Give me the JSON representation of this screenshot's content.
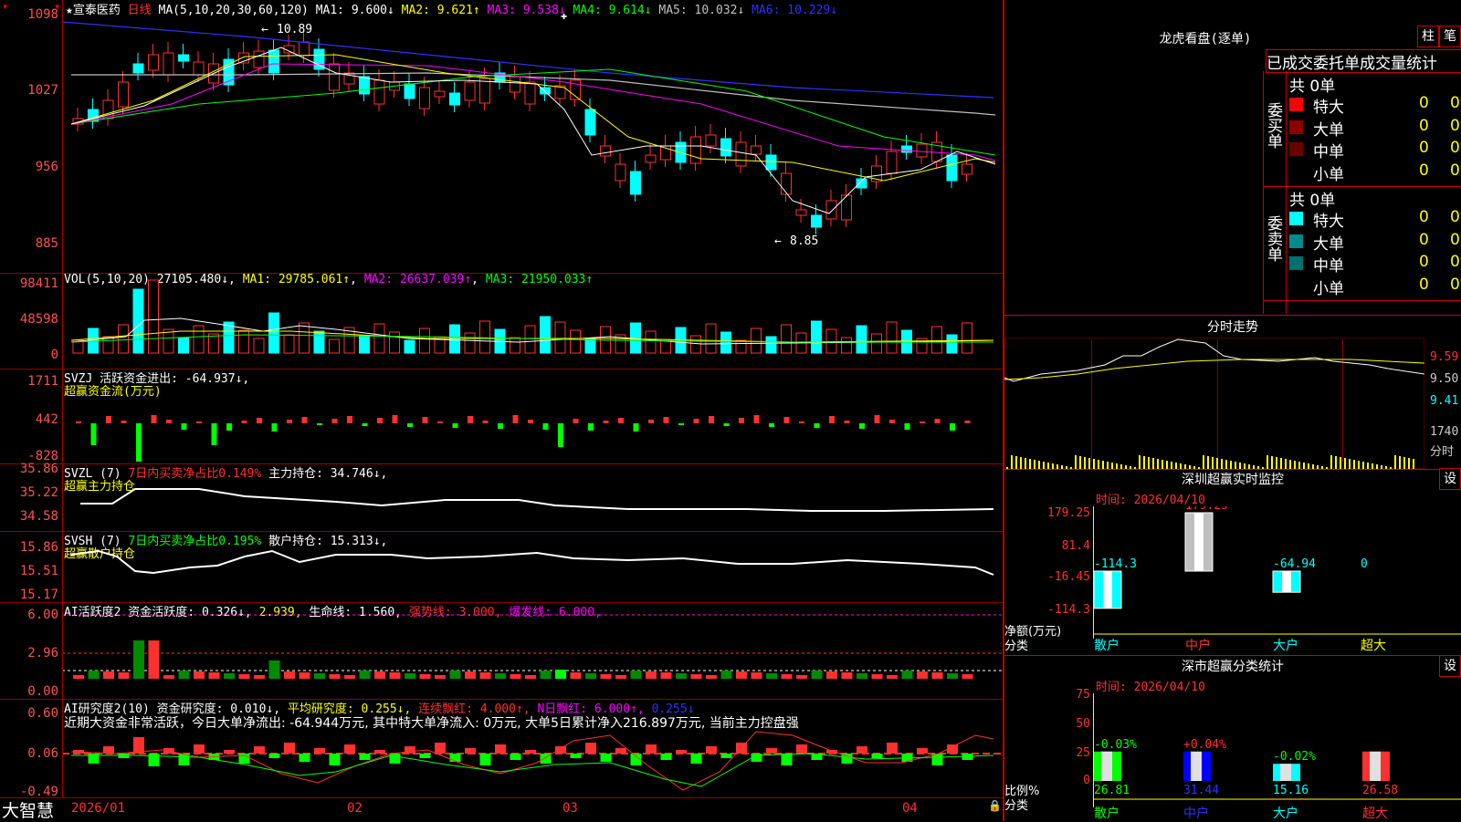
{
  "stock": {
    "name": "★宣泰医药",
    "period": "日线",
    "ma_label": "MA(5,10,20,30,60,120)",
    "ma": [
      {
        "label": "MA1: 9.600↓",
        "color": "#ffffff"
      },
      {
        "label": "MA2: 9.621↑",
        "color": "#ffff00"
      },
      {
        "label": "MA3: 9.538↓",
        "color": "#ff00ff"
      },
      {
        "label": "MA4: 9.614↓",
        "color": "#00ff00"
      },
      {
        "label": "MA5: 10.032↓",
        "color": "#c0c0c0"
      },
      {
        "label": "MA6: 10.229↓",
        "color": "#3030ff"
      }
    ],
    "high_mark": "10.89",
    "low_mark": "8.85",
    "y_ticks": [
      "1098",
      "1027",
      "956",
      "885"
    ]
  },
  "vol": {
    "title": "VOL(5,10,20)",
    "value": "27105.480↓",
    "ma1": "MA1: 29785.061↑",
    "ma2": "MA2: 26637.039↑",
    "ma3": "MA3: 21950.033↑",
    "y_ticks": [
      "98411",
      "48598",
      "0"
    ]
  },
  "svzj": {
    "title": "SVZJ  活跃资金进出: -64.937↓,",
    "subtitle": "超赢资金流(万元)",
    "y_ticks": [
      "1711",
      "442",
      "-828"
    ]
  },
  "svzl": {
    "title": "SVZL (7)",
    "ratio": "7日内买卖净占比0.149%",
    "hold": "主力持仓: 34.746↓,",
    "subtitle": "超赢主力持仓",
    "y_ticks": [
      "35.86",
      "35.22",
      "34.58"
    ]
  },
  "svsh": {
    "title": "SVSH (7)",
    "ratio": "7日内买卖净占比0.195%",
    "hold": "散户持仓: 15.313↓,",
    "subtitle": "超赢散户持仓",
    "y_ticks": [
      "15.86",
      "15.51",
      "15.17"
    ]
  },
  "ai1": {
    "title": "AI活跃度2 资金活跃度: 0.326↓,",
    "v2": "2.939,",
    "life": "生命线: 1.560,",
    "strong": "强势线: 3.000,",
    "burst": "爆发线: 6.000,",
    "y_ticks": [
      "6.00",
      "2.96",
      "0.00"
    ]
  },
  "ai2": {
    "title": "AI研究度2(10) 资金研究度: 0.010↓,",
    "avg": "平均研究度: 0.255↓,",
    "cont": "连续飘红: 4.000↑,",
    "nday": "N日飘红: 6.000↑,",
    "last": "0.255↓",
    "commentary": "近期大资金非常活跃，今日大单净流出: -64.944万元, 其中特大单净流入: 0万元, 大单5日累计净入216.897万元, 当前主力控盘强",
    "y_ticks": [
      "0.60",
      "0.06",
      "-0.49"
    ]
  },
  "xaxis": {
    "labels": [
      "2026/01",
      "02",
      "03",
      "04"
    ]
  },
  "brand": "大智慧",
  "dragon": {
    "title": "龙虎看盘(逐单)",
    "btn_zhu": "柱",
    "btn_bi": "笔",
    "tabs": "已成交委托单成交量统计",
    "buy_label": "委买单",
    "sell_label": "委卖单",
    "buy_total": "共 0单",
    "sell_total": "共 0单",
    "rows": [
      "特大",
      "大单",
      "中单",
      "小单"
    ],
    "count": "0",
    "pct": "0%",
    "buy_colors": [
      "#ff0000",
      "#8b0000",
      "#6b0000",
      ""
    ],
    "sell_colors": [
      "#00ffff",
      "#008b8b",
      "#007070",
      ""
    ]
  },
  "timeshare": {
    "title": "分时走势",
    "prices": [
      "9.59",
      "9.50",
      "9.41"
    ],
    "vol_max": "1740",
    "vol_label": "分时"
  },
  "sz_monitor": {
    "title": "深圳超赢实时监控",
    "btn": "设",
    "time": "时间: 2026/04/10",
    "y_ticks": [
      "179.25",
      "81.4",
      "-16.45",
      "-114.3"
    ],
    "y_label": "净额(万元)",
    "x_label": "分类",
    "categories": [
      "散户",
      "中户",
      "大户",
      "超大"
    ],
    "values": [
      "-114.3",
      "179.25",
      "-64.94",
      "0"
    ]
  },
  "sz_class": {
    "title": "深市超赢分类统计",
    "btn": "设",
    "time": "时间: 2026/04/10",
    "y_ticks": [
      "75",
      "50",
      "25",
      "0"
    ],
    "y_label": "比例%",
    "x_label": "分类",
    "categories": [
      "散户",
      "中户",
      "大户",
      "超大"
    ],
    "changes": [
      "-0.03%",
      "+0.04%",
      "-0.02%",
      ""
    ],
    "values": [
      "26.81",
      "31.44",
      "15.16",
      "26.58"
    ]
  }
}
